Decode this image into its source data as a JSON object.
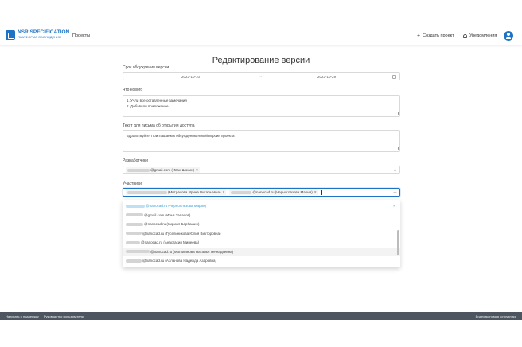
{
  "header": {
    "logo_title": "NSR SPECIFICATION",
    "logo_subtitle": "ПЛАТФОРМА ОБСУЖДЕНИЯ",
    "nav_projects": "Проекты",
    "create_project": "Создать проект",
    "notifications": "Уведомления"
  },
  "page_title": "Редактирование версии",
  "period": {
    "label": "Срок обсуждения версии",
    "start": "2023-10-10",
    "separator": "→",
    "end": "2023-10-29"
  },
  "whats_new": {
    "label": "Что нового",
    "lines": [
      "1. Учли все оставленные замечания",
      "2. Добавили приложение"
    ]
  },
  "invite_text": {
    "label": "Текст для письма об открытии доступа",
    "value": "Здравствуйте! Приглашаем к обсуждению новой версии проекта"
  },
  "developers": {
    "label": "Разработчики",
    "tags": [
      {
        "email": "@gmail.com",
        "name": "(Иван Шохин)"
      }
    ]
  },
  "participants": {
    "label": "Участники",
    "tags": [
      {
        "email": "",
        "name": "(Митрахова Ирина Витальевна)"
      },
      {
        "email": "@nanocad.ru",
        "name": "(Черноглазова Мария)"
      }
    ]
  },
  "dropdown_options": [
    {
      "email": "@nanocad.ru",
      "name": "(Чернослезова Мария)",
      "selected": true
    },
    {
      "email": "@gmail.com",
      "name": "(Илья Тапасов)"
    },
    {
      "email": "@nanocad.ru",
      "name": "(Кирилл Барбашин)"
    },
    {
      "email": "@nanocad.ru",
      "name": "(Гусельникова Юлия Викторовна)"
    },
    {
      "email": "@nanocad.ru",
      "name": "(Анастасия Минеева)"
    },
    {
      "email": "@nanocad.ru",
      "name": "(Молоканова Наталья Геннадьевна)",
      "hover": true
    },
    {
      "email": "@nanocad.ru",
      "name": "(Асланова Надежда Азаровна)"
    }
  ],
  "footer": {
    "support": "Написать в поддержку",
    "guide": "Руководство пользователя",
    "right": "Видеоэкономия сотрудника"
  },
  "colors": {
    "accent": "#1e73c4",
    "footer_bg": "#4d5660",
    "selected_option": "#3aa0d8"
  }
}
